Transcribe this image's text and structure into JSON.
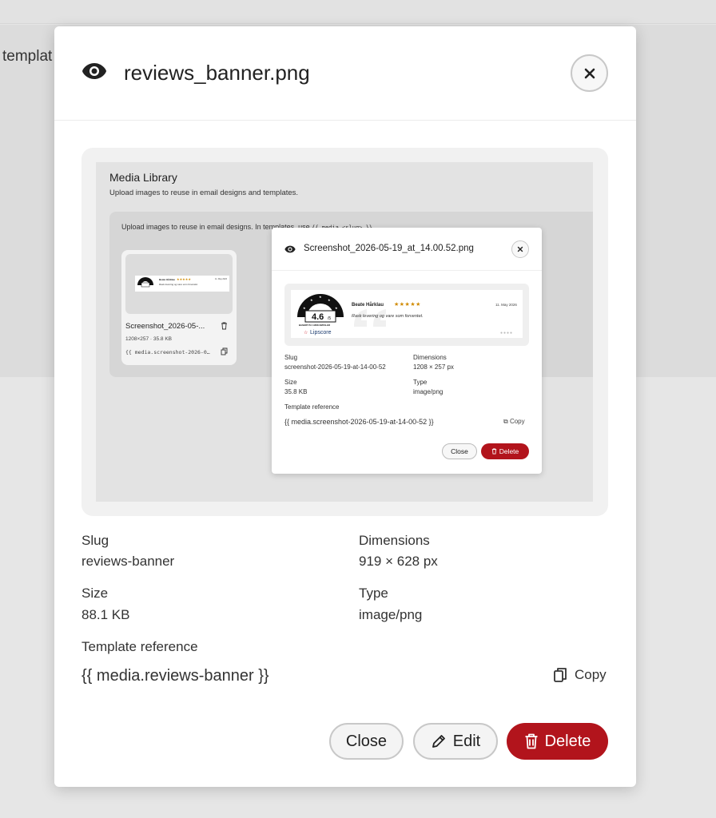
{
  "background": {
    "text": "templat"
  },
  "modal": {
    "title": "reviews_banner.png",
    "fields": {
      "slug_label": "Slug",
      "slug_value": "reviews-banner",
      "dimensions_label": "Dimensions",
      "dimensions_value": "919 × 628 px",
      "size_label": "Size",
      "size_value": "88.1 KB",
      "type_label": "Type",
      "type_value": "image/png",
      "template_reference_label": "Template reference",
      "template_reference_value": "{{ media.reviews-banner }}"
    },
    "copy_label": "Copy",
    "close_label": "Close",
    "edit_label": "Edit",
    "delete_label": "Delete"
  },
  "preview_screenshot": {
    "title": "Media Library",
    "subtitle": "Upload images to reuse in email designs and templates.",
    "card_text": "Upload images to reuse in email designs. In templates, use",
    "card_code": "{{ media.<slug> }}",
    "tile": {
      "name": "Screenshot_2026-05-...",
      "meta": "1208×257 · 35.8 KB",
      "ref": "{{ media.screenshot-2026-0…"
    },
    "inner_modal": {
      "title": "Screenshot_2026-05-19_at_14.00.52.png",
      "slug_label": "Slug",
      "slug_value": "screenshot-2026-05-19-at-14-00-52",
      "dimensions_label": "Dimensions",
      "dimensions_value": "1208 × 257 px",
      "size_label": "Size",
      "size_value": "35.8 KB",
      "type_label": "Type",
      "type_value": "image/png",
      "template_reference_label": "Template reference",
      "template_reference_value": "{{ media.screenshot-2026-05-19-at-14-00-52 }}",
      "copy_label": "Copy",
      "close_label": "Close",
      "delete_label": "Delete"
    },
    "review": {
      "score": "4.6",
      "score_suffix": "/5",
      "score_caption": "BASERT PÅ 11658 OMTALER",
      "brand": "Lipscore",
      "reviewer": "Beate Hårklau",
      "stars": "★★★★★",
      "text": "Rask levering og vare som forventet.",
      "date": "11. May 2026"
    }
  },
  "colors": {
    "accent_danger": "#b2141c",
    "border": "#c8c8c8",
    "star": "#d08a00"
  },
  "icons": [
    "eye-icon",
    "close-icon",
    "copy-icon",
    "pencil-icon",
    "trash-icon",
    "star-icon"
  ]
}
